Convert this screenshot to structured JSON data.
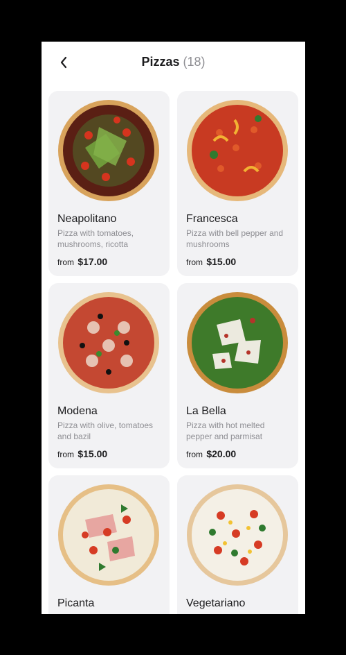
{
  "header": {
    "title": "Pizzas",
    "count": "(18)"
  },
  "items": [
    {
      "name": "Neapolitano",
      "description": "Pizza with tomatoes, mushrooms, ricotta",
      "price_prefix": "from",
      "price": "$17.00"
    },
    {
      "name": "Francesca",
      "description": "Pizza with bell pepper and mushrooms",
      "price_prefix": "from",
      "price": "$15.00"
    },
    {
      "name": "Modena",
      "description": "Pizza with olive, tomatoes and bazil",
      "price_prefix": "from",
      "price": "$15.00"
    },
    {
      "name": "La Bella",
      "description": "Pizza with hot melted pepper and parmisat",
      "price_prefix": "from",
      "price": "$20.00"
    },
    {
      "name": "Picanta",
      "description": "",
      "price_prefix": "",
      "price": ""
    },
    {
      "name": "Vegetariano",
      "description": "",
      "price_prefix": "",
      "price": ""
    }
  ],
  "colors": {
    "card_bg": "#f2f2f4",
    "text": "#1c1c1e",
    "muted": "#8e8e93"
  },
  "icons": {
    "back": "chevron-left-icon"
  }
}
